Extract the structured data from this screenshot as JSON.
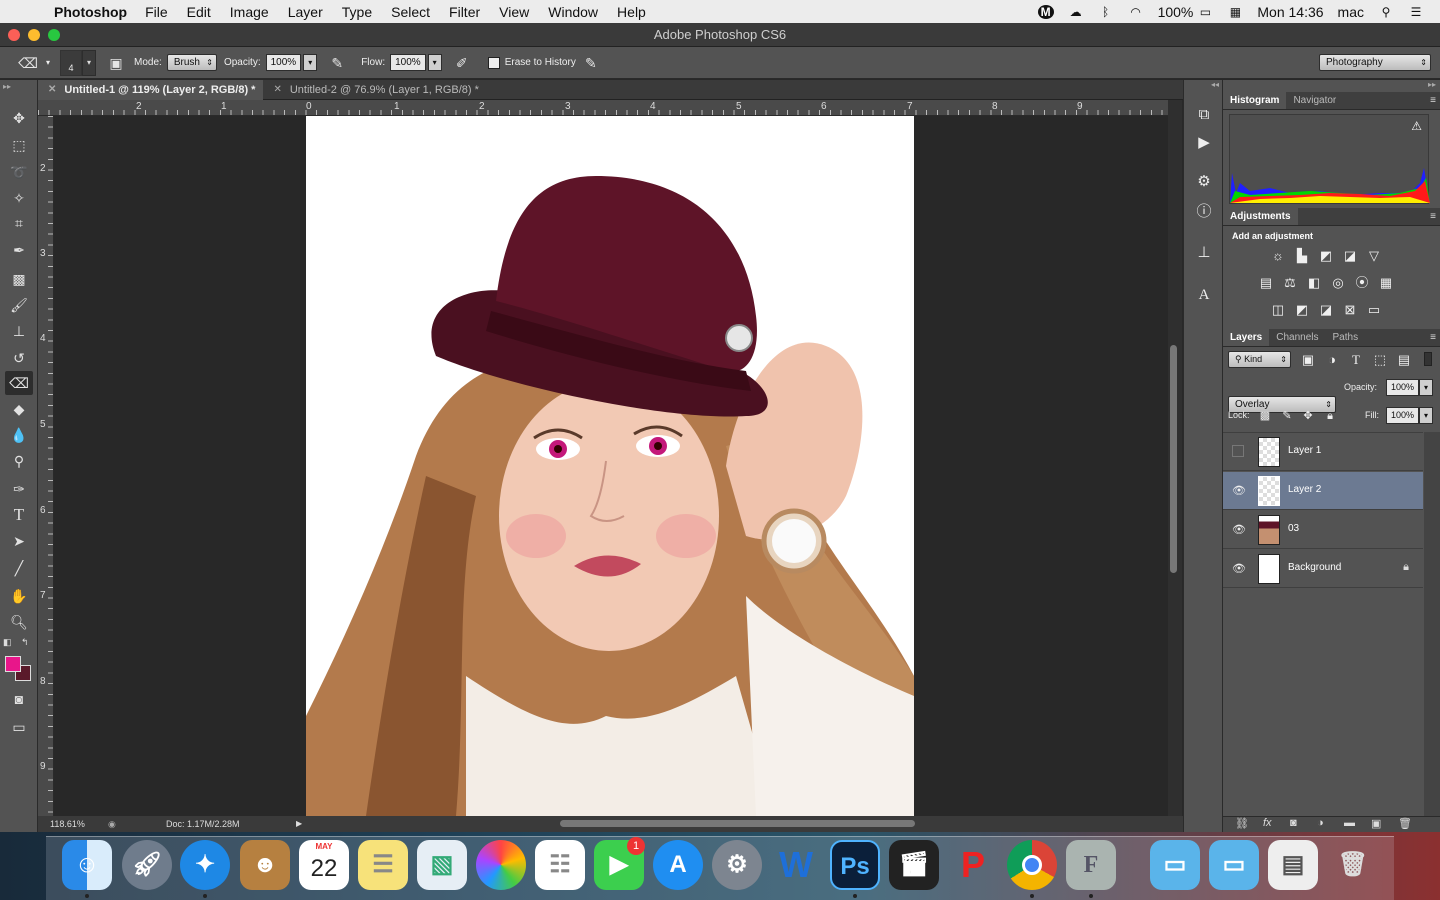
{
  "menubar": {
    "app_name": "Photoshop",
    "items": [
      "File",
      "Edit",
      "Image",
      "Layer",
      "Type",
      "Select",
      "Filter",
      "View",
      "Window",
      "Help"
    ],
    "battery": "100%",
    "clock": "Mon 14:36",
    "user": "mac"
  },
  "window": {
    "title": "Adobe Photoshop CS6"
  },
  "options_bar": {
    "brush_size": "4",
    "mode_label": "Mode:",
    "mode_value": "Brush",
    "opacity_label": "Opacity:",
    "opacity_value": "100%",
    "flow_label": "Flow:",
    "flow_value": "100%",
    "erase_history_label": "Erase to History",
    "workspace": "Photography"
  },
  "tabs": [
    {
      "label": "Untitled-1 @ 119% (Layer 2, RGB/8) *",
      "active": true
    },
    {
      "label": "Untitled-2 @ 76.9% (Layer 1, RGB/8) *",
      "active": false
    }
  ],
  "rulers": {
    "h": [
      "2",
      "1",
      "0",
      "1",
      "2",
      "3",
      "4",
      "5",
      "6",
      "7",
      "8",
      "9"
    ],
    "v": [
      "2",
      "3",
      "4",
      "5",
      "6",
      "7",
      "8",
      "9"
    ]
  },
  "statusbar": {
    "zoom": "118.61%",
    "doc": "Doc: 1.17M/2.28M"
  },
  "histogram_panel": {
    "tabs": [
      "Histogram",
      "Navigator"
    ]
  },
  "adjustments_panel": {
    "tab": "Adjustments",
    "heading": "Add an adjustment"
  },
  "layers_panel": {
    "tabs": [
      "Layers",
      "Channels",
      "Paths"
    ],
    "filter_label": "Kind",
    "blend_mode": "Overlay",
    "opacity_label": "Opacity:",
    "opacity_value": "100%",
    "lock_label": "Lock:",
    "fill_label": "Fill:",
    "fill_value": "100%",
    "layers": [
      {
        "name": "Layer 1",
        "visible": false,
        "selected": false
      },
      {
        "name": "Layer 2",
        "visible": true,
        "selected": true
      },
      {
        "name": "03",
        "visible": true,
        "selected": false
      },
      {
        "name": "Background",
        "visible": true,
        "selected": false,
        "locked": true
      }
    ]
  },
  "dock": {
    "calendar_month": "MAY",
    "calendar_day": "22",
    "facetime_badge": "1"
  },
  "colors": {
    "foreground": "#e8168a",
    "background": "#5a1a2a",
    "selected_layer": "#6c7a92"
  }
}
